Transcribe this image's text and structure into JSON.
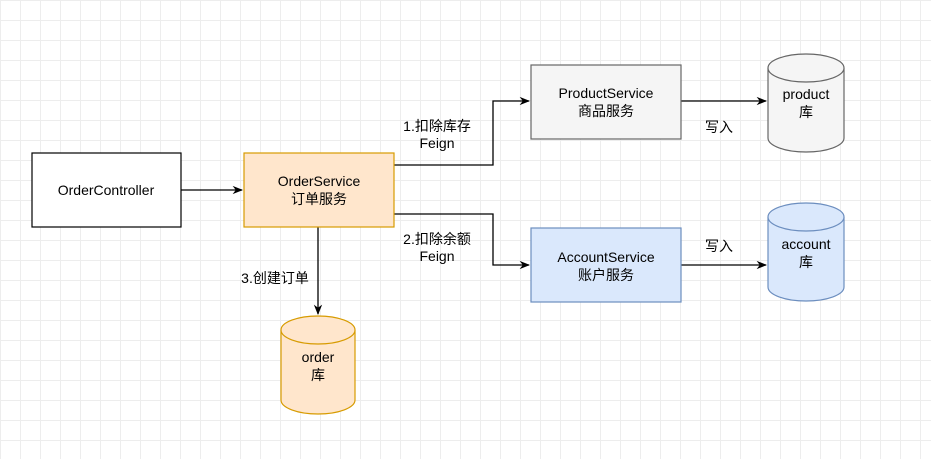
{
  "nodes": {
    "order_controller": {
      "line1": "OrderController"
    },
    "order_service": {
      "line1": "OrderService",
      "line2": "订单服务"
    },
    "product_service": {
      "line1": "ProductService",
      "line2": "商品服务"
    },
    "account_service": {
      "line1": "AccountService",
      "line2": "账户服务"
    },
    "product_db": {
      "line1": "product",
      "line2": "库"
    },
    "account_db": {
      "line1": "account",
      "line2": "库"
    },
    "order_db": {
      "line1": "order",
      "line2": "库"
    }
  },
  "edges": {
    "deduct_stock": {
      "line1": "1.扣除库存",
      "line2": "Feign"
    },
    "deduct_balance": {
      "line1": "2.扣除余额",
      "line2": "Feign"
    },
    "create_order": {
      "line1": "3.创建订单"
    },
    "write_product": {
      "line1": "写入"
    },
    "write_account": {
      "line1": "写入"
    }
  },
  "colors": {
    "order_fill": "#ffe6cc",
    "order_stroke": "#d79b00",
    "product_fill": "#f5f5f5",
    "product_stroke": "#666666",
    "account_fill": "#dae8fc",
    "account_stroke": "#6c8ebf"
  }
}
